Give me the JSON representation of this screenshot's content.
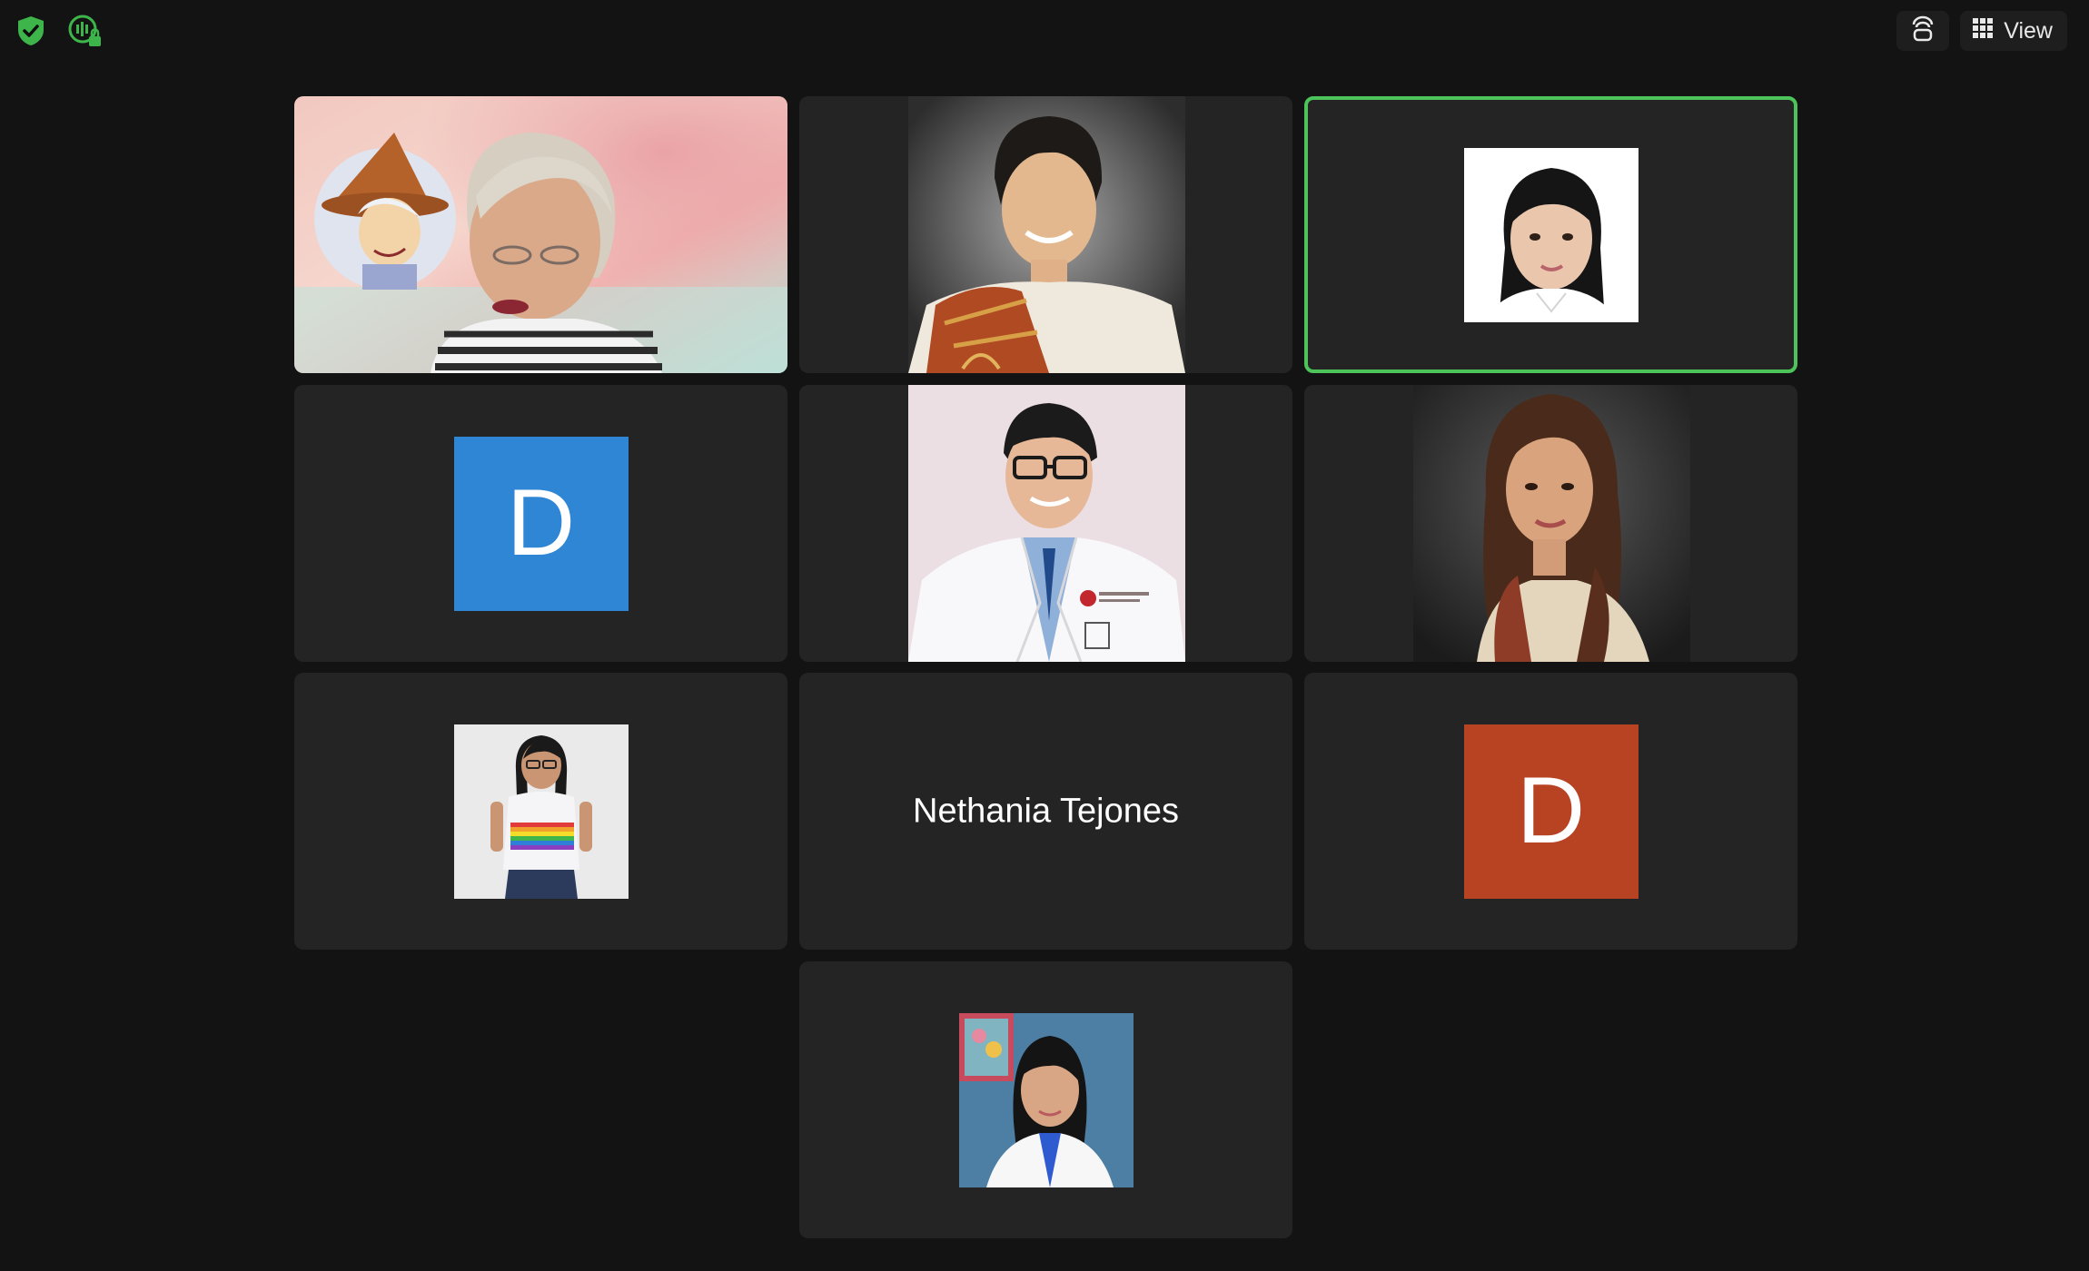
{
  "toolbar": {
    "view_label": "View",
    "icons": [
      "shield-check-icon",
      "live-transcript-lock-icon",
      "immersive-view-icon",
      "grid-icon"
    ]
  },
  "colors": {
    "background": "#131313",
    "tile": "#242424",
    "active_border": "#4dc45a",
    "avatar_blue": "#2f86d4",
    "avatar_red": "#b84323"
  },
  "tiles": [
    {
      "type": "video",
      "description_icon": "participant-video"
    },
    {
      "type": "profile-photo"
    },
    {
      "type": "profile-photo",
      "active_speaker": true
    },
    {
      "type": "avatar-letter",
      "letter": "D",
      "color": "#2f86d4"
    },
    {
      "type": "profile-photo"
    },
    {
      "type": "profile-photo"
    },
    {
      "type": "profile-photo"
    },
    {
      "type": "name",
      "name": "Nethania Tejones"
    },
    {
      "type": "avatar-letter",
      "letter": "D",
      "color": "#b84323"
    },
    {
      "type": "profile-photo"
    }
  ]
}
